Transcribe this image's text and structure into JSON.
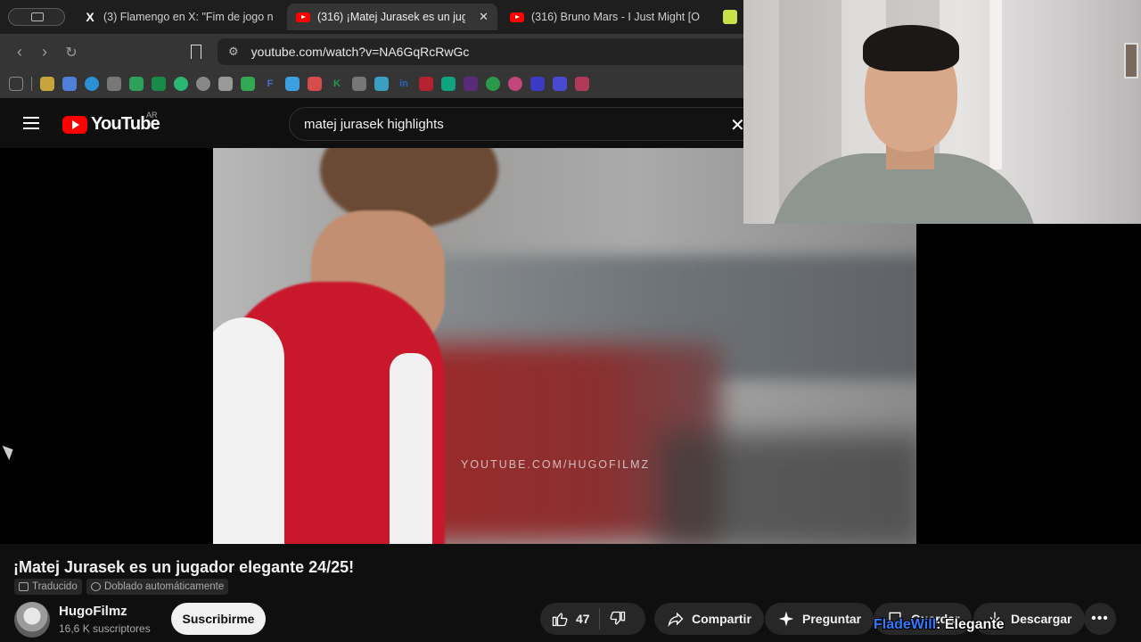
{
  "browser": {
    "tabs": [
      {
        "title": "(3) Flamengo en X: \"Fim de jogo n",
        "icon": "x-icon",
        "active": false
      },
      {
        "title": "(316) ¡Matej Jurasek es un jug",
        "icon": "youtube-icon",
        "active": true
      },
      {
        "title": "(316) Bruno Mars - I Just Might [O",
        "icon": "youtube-icon",
        "active": false
      }
    ],
    "url": "youtube.com/watch?v=NA6GqRcRwGc"
  },
  "bookmarks": [
    {
      "icon": "apps-grid-icon",
      "color": "#5f6368"
    },
    {
      "icon": "bookmark-yellow-icon",
      "color": "#c7a53a"
    },
    {
      "icon": "calendar-icon",
      "color": "#4f7fd8"
    },
    {
      "icon": "edge-icon",
      "color": "#2d8fd6"
    },
    {
      "icon": "openai-icon",
      "color": "#777777"
    },
    {
      "icon": "drive-icon",
      "color": "#2da15a"
    },
    {
      "icon": "meet-icon",
      "color": "#1a8a4a"
    },
    {
      "icon": "circle-green-icon",
      "color": "#2bb673"
    },
    {
      "icon": "dots-icon",
      "color": "#888888"
    },
    {
      "icon": "gear-icon",
      "color": "#999999"
    },
    {
      "icon": "sheets-icon",
      "color": "#33a852"
    },
    {
      "icon": "f-icon",
      "color": "#4a6fd1"
    },
    {
      "icon": "diamond-icon",
      "color": "#3da0e0"
    },
    {
      "icon": "gmail-icon",
      "color": "#d64b4b"
    },
    {
      "icon": "k-icon",
      "color": "#1d9e46"
    },
    {
      "icon": "openai-icon",
      "color": "#777777"
    },
    {
      "icon": "dash-icon",
      "color": "#3a9ec2"
    },
    {
      "icon": "linkedin-icon",
      "color": "#2a66c2"
    },
    {
      "icon": "red-icon",
      "color": "#b4232f"
    },
    {
      "icon": "chatgpt-icon",
      "color": "#10a37f"
    },
    {
      "icon": "purple-icon",
      "color": "#5a2a7a"
    },
    {
      "icon": "green-ball-icon",
      "color": "#2a9a4a"
    },
    {
      "icon": "pink-dot-icon",
      "color": "#c2467a"
    },
    {
      "icon": "flag-icon",
      "color": "#3a3ac2"
    },
    {
      "icon": "blue-sq-icon",
      "color": "#4a4ad1"
    },
    {
      "icon": "trend-icon",
      "color": "#b03a5a"
    }
  ],
  "youtube": {
    "logo_text": "YouTube",
    "country": "AR",
    "search_value": "matej jurasek highlights"
  },
  "video": {
    "watermark": "YOUTUBE.COM/HUGOFILMZ",
    "title": "¡Matej Jurasek es un jugador elegante 24/25!",
    "chips": [
      "Traducido",
      "Doblado automáticamente"
    ]
  },
  "channel": {
    "name": "HugoFilmz",
    "subscribers": "16,6 K suscriptores",
    "subscribe_label": "Suscribirme"
  },
  "actions": {
    "likes": "47",
    "share": "Compartir",
    "ask": "Preguntar",
    "save": "Guardar",
    "download": "Descargar"
  },
  "overlay": {
    "name": "FladeWill",
    "text": ": Elegante"
  }
}
